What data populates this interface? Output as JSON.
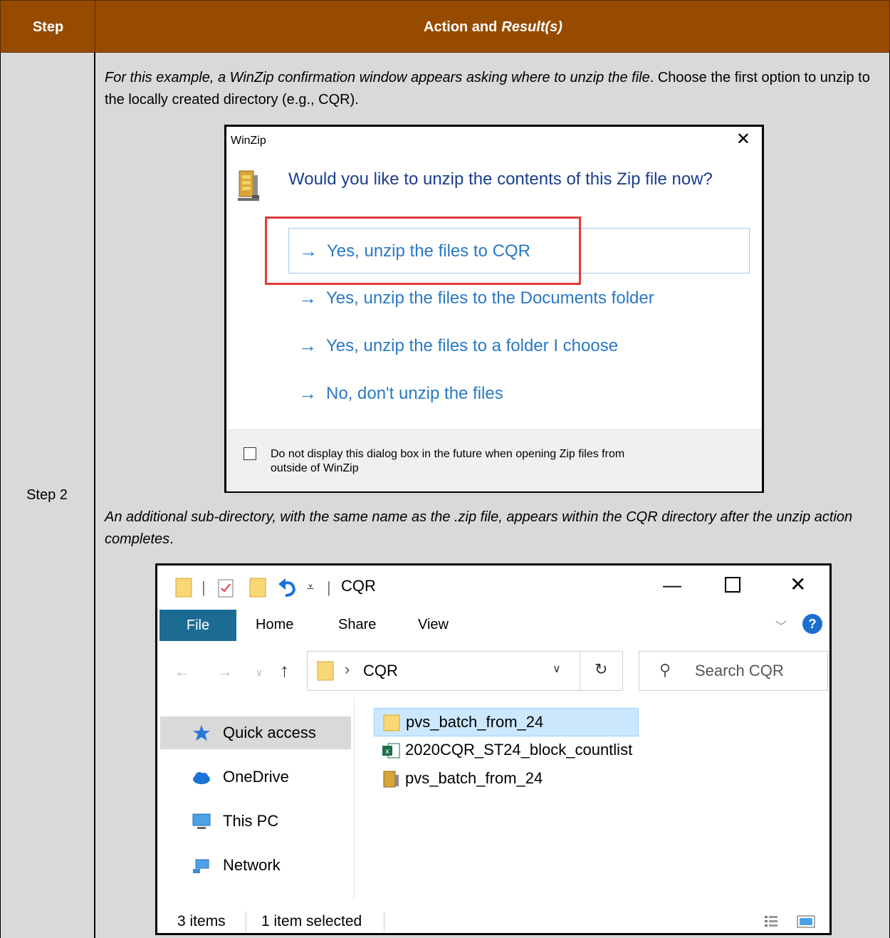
{
  "table": {
    "header_step": "Step",
    "header_action": "Action and",
    "header_result": "Result(s)",
    "step_label": "Step 2"
  },
  "para1": {
    "italic": "For this example, a WinZip confirmation window appears asking where to unzip the file",
    "normal": ". Choose the first option to unzip to the locally created directory (e.g., CQR)."
  },
  "para2": {
    "italic": "An additional sub-directory, with the same name as the .zip file, appears within the CQR directory after the unzip action completes",
    "normal": "."
  },
  "winzip": {
    "title": "WinZip",
    "close": "✕",
    "question": "Would you like to unzip the contents of this Zip file now?",
    "options": [
      "Yes, unzip the files to CQR",
      "Yes, unzip the files to the Documents folder",
      "Yes, unzip the files to a folder I choose",
      "No, don't unzip the files"
    ],
    "arrow": "→",
    "footer_text": "Do not display this dialog box in the future when opening Zip files from outside of WinZip",
    "highlight_color": "#e13b3b"
  },
  "explorer": {
    "title": "CQR",
    "ribbon_tabs": [
      "File",
      "Home",
      "Share",
      "View"
    ],
    "address": "CQR",
    "search_placeholder": "Search CQR",
    "nav_items": [
      "Quick access",
      "OneDrive",
      "This PC",
      "Network"
    ],
    "files": [
      "pvs_batch_from_24",
      "2020CQR_ST24_block_countlist",
      "pvs_batch_from_24"
    ],
    "status_count": "3 items",
    "status_selected": "1 item selected",
    "help": "?"
  },
  "colors": {
    "header_bg": "#964B00",
    "cell_bg": "#d9d9d9",
    "link_blue": "#2a78c4",
    "file_tab": "#1c6b92"
  }
}
